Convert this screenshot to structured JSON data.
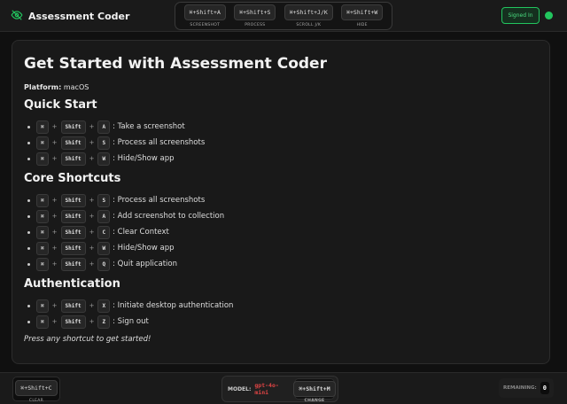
{
  "header": {
    "title": "Assessment Coder",
    "logo_icon": "eye-off-icon",
    "shortcuts": [
      {
        "keys": "⌘+Shift+A",
        "label": "SCREENSHOT"
      },
      {
        "keys": "⌘+Shift+S",
        "label": "PROCESS"
      },
      {
        "keys": "⌘+Shift+J/K",
        "label": "SCROLL J/K"
      },
      {
        "keys": "⌘+Shift+W",
        "label": "HIDE"
      }
    ],
    "signed_in": "Signed In",
    "status_color": "#22c55e"
  },
  "main": {
    "title": "Get Started with Assessment Coder",
    "platform_label": "Platform:",
    "platform_value": "macOS",
    "sections": [
      {
        "title": "Quick Start",
        "items": [
          {
            "key": "A",
            "desc": ": Take a screenshot"
          },
          {
            "key": "S",
            "desc": ": Process all screenshots"
          },
          {
            "key": "W",
            "desc": ": Hide/Show app"
          }
        ]
      },
      {
        "title": "Core Shortcuts",
        "items": [
          {
            "key": "S",
            "desc": ": Process all screenshots"
          },
          {
            "key": "A",
            "desc": ": Add screenshot to collection"
          },
          {
            "key": "C",
            "desc": ": Clear Context"
          },
          {
            "key": "W",
            "desc": ": Hide/Show app"
          },
          {
            "key": "Q",
            "desc": ": Quit application"
          }
        ]
      },
      {
        "title": "Authentication",
        "items": [
          {
            "key": "X",
            "desc": ": Initiate desktop authentication"
          },
          {
            "key": "Z",
            "desc": ": Sign out"
          }
        ]
      }
    ],
    "cmd": "⌘",
    "shift": "Shift",
    "plus": "+",
    "footer": "Press any shortcut to get started!"
  },
  "bottom": {
    "clear_keys": "⌘+Shift+C",
    "clear_label": "CLEAR",
    "model_label": "MODEL:",
    "model_value": "gpt-4o-mini",
    "model_color": "#e04444",
    "change_keys": "⌘+Shift+M",
    "change_label": "CHANGE",
    "remaining_label": "REMAINING:",
    "remaining_value": "0"
  }
}
